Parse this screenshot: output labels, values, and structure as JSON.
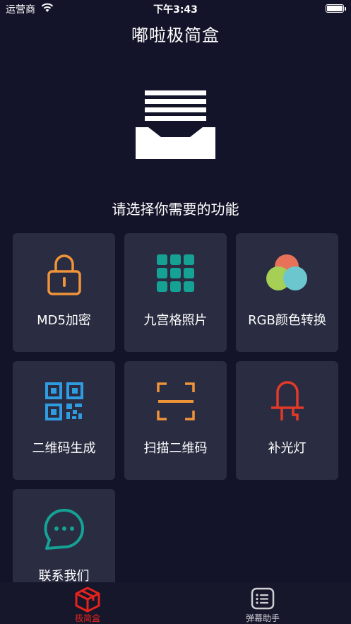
{
  "status_bar": {
    "carrier": "运营商",
    "time": "下午3:43"
  },
  "nav": {
    "title": "嘟啦极简盒"
  },
  "hero": {
    "icon": "inbox-tray-icon"
  },
  "subtitle": "请选择你需要的功能",
  "features": [
    {
      "label": "MD5加密",
      "icon": "padlock-icon",
      "color": "#f0943a"
    },
    {
      "label": "九宫格照片",
      "icon": "nine-grid-icon",
      "color": "#16a195"
    },
    {
      "label": "RGB颜色转换",
      "icon": "color-circles-icon",
      "colors": [
        "#e8715a",
        "#a5cf55",
        "#6cc6cd"
      ]
    },
    {
      "label": "二维码生成",
      "icon": "qr-code-icon",
      "color": "#2f9be0"
    },
    {
      "label": "扫描二维码",
      "icon": "scan-frame-icon",
      "color": "#f0943a"
    },
    {
      "label": "补光灯",
      "icon": "led-light-icon",
      "color": "#e23a28"
    },
    {
      "label": "联系我们",
      "icon": "chat-bubble-icon",
      "color": "#16a195"
    }
  ],
  "tabs": [
    {
      "label": "极简盒",
      "icon": "box-icon",
      "active": true,
      "color": "#e5231c"
    },
    {
      "label": "弹幕助手",
      "icon": "message-list-icon",
      "active": false,
      "color": "#cfcfd6"
    }
  ]
}
